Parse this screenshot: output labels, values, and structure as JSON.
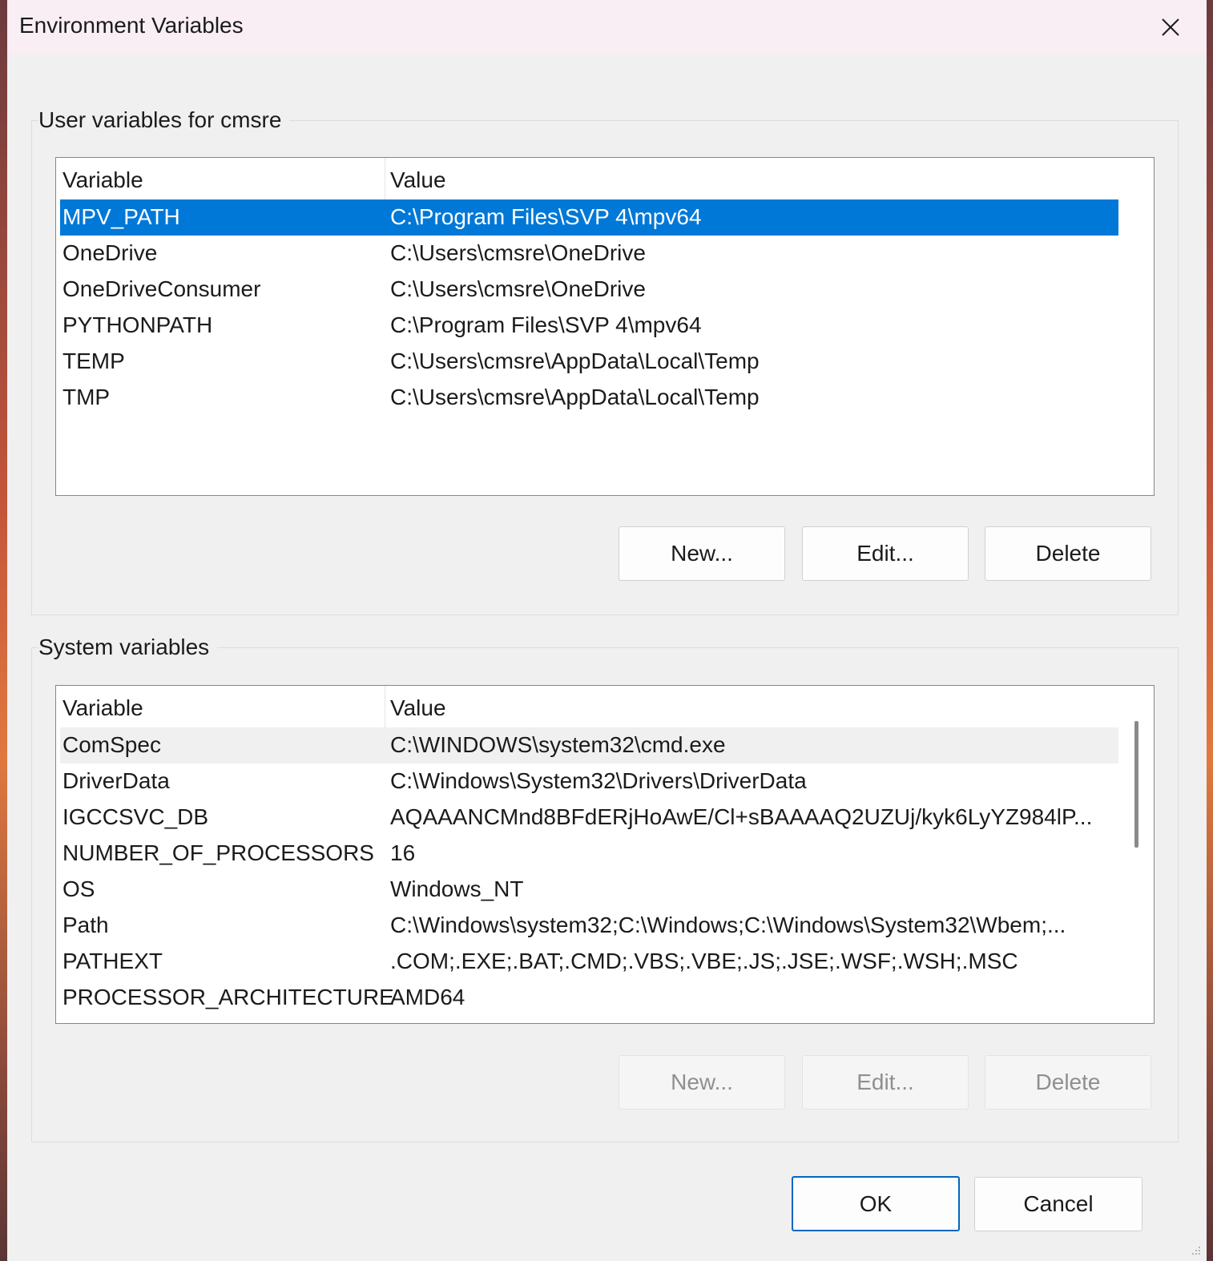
{
  "window": {
    "title": "Environment Variables"
  },
  "user_group": {
    "label": "User variables for cmsre",
    "columns": [
      "Variable",
      "Value"
    ],
    "rows": [
      {
        "variable": "MPV_PATH",
        "value": "C:\\Program Files\\SVP 4\\mpv64",
        "selected": true
      },
      {
        "variable": "OneDrive",
        "value": "C:\\Users\\cmsre\\OneDrive"
      },
      {
        "variable": "OneDriveConsumer",
        "value": "C:\\Users\\cmsre\\OneDrive"
      },
      {
        "variable": "PYTHONPATH",
        "value": "C:\\Program Files\\SVP 4\\mpv64"
      },
      {
        "variable": "TEMP",
        "value": "C:\\Users\\cmsre\\AppData\\Local\\Temp"
      },
      {
        "variable": "TMP",
        "value": "C:\\Users\\cmsre\\AppData\\Local\\Temp"
      }
    ],
    "buttons": {
      "new": "New...",
      "edit": "Edit...",
      "delete": "Delete"
    }
  },
  "system_group": {
    "label": "System variables",
    "columns": [
      "Variable",
      "Value"
    ],
    "rows": [
      {
        "variable": "ComSpec",
        "value": "C:\\WINDOWS\\system32\\cmd.exe"
      },
      {
        "variable": "DriverData",
        "value": "C:\\Windows\\System32\\Drivers\\DriverData"
      },
      {
        "variable": "IGCCSVC_DB",
        "value": "AQAAANCMnd8BFdERjHoAwE/Cl+sBAAAAQ2UZUj/kyk6LyYZ984lP..."
      },
      {
        "variable": "NUMBER_OF_PROCESSORS",
        "value": "16"
      },
      {
        "variable": "OS",
        "value": "Windows_NT"
      },
      {
        "variable": "Path",
        "value": "C:\\Windows\\system32;C:\\Windows;C:\\Windows\\System32\\Wbem;..."
      },
      {
        "variable": "PATHEXT",
        "value": ".COM;.EXE;.BAT;.CMD;.VBS;.VBE;.JS;.JSE;.WSF;.WSH;.MSC"
      },
      {
        "variable": "PROCESSOR_ARCHITECTURE",
        "value": "AMD64"
      }
    ],
    "buttons": {
      "new": "New...",
      "edit": "Edit...",
      "delete": "Delete"
    }
  },
  "footer": {
    "ok": "OK",
    "cancel": "Cancel"
  },
  "colors": {
    "selection": "#0078d7",
    "dialog_bg": "#f0f0f0",
    "titlebar_bg": "#f8eef3"
  }
}
